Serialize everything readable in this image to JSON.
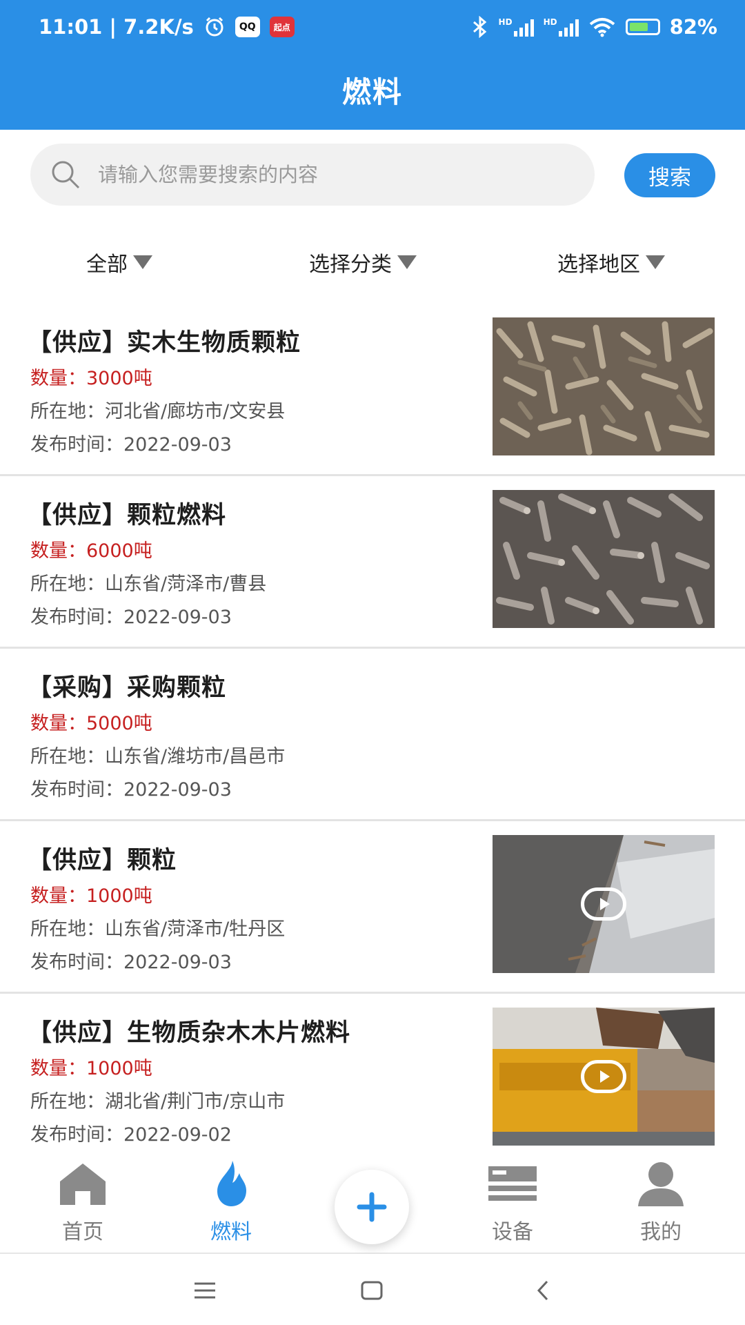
{
  "status_bar": {
    "time_speed": "11:01 | 7.2K/s",
    "qq_badge": "QQ",
    "qidian_badge": "起点",
    "hd1": "HD",
    "hd2": "HD",
    "battery": "82%"
  },
  "header": {
    "title": "燃料"
  },
  "search": {
    "placeholder": "请输入您需要搜索的内容",
    "button": "搜索"
  },
  "filters": [
    "全部",
    "选择分类",
    "选择地区"
  ],
  "listings": [
    {
      "title": "【供应】实木生物质颗粒",
      "quantity": "数量：3000吨",
      "location": "所在地：河北省/廊坊市/文安县",
      "date": "发布时间：2022-09-03",
      "media": "image"
    },
    {
      "title": "【供应】颗粒燃料",
      "quantity": "数量：6000吨",
      "location": "所在地：山东省/菏泽市/曹县",
      "date": "发布时间：2022-09-03",
      "media": "image"
    },
    {
      "title": "【采购】采购颗粒",
      "quantity": "数量：5000吨",
      "location": "所在地：山东省/潍坊市/昌邑市",
      "date": "发布时间：2022-09-03",
      "media": "none"
    },
    {
      "title": "【供应】颗粒",
      "quantity": "数量：1000吨",
      "location": "所在地：山东省/菏泽市/牡丹区",
      "date": "发布时间：2022-09-03",
      "media": "video"
    },
    {
      "title": "【供应】生物质杂木木片燃料",
      "quantity": "数量：1000吨",
      "location": "所在地：湖北省/荆门市/京山市",
      "date": "发布时间：2022-09-02",
      "media": "video"
    }
  ],
  "tabs": [
    {
      "label": "首页",
      "icon": "home-icon",
      "active": false
    },
    {
      "label": "燃料",
      "icon": "flame-icon",
      "active": true
    },
    {
      "label": "设备",
      "icon": "equipment-icon",
      "active": false
    },
    {
      "label": "我的",
      "icon": "profile-icon",
      "active": false
    }
  ],
  "colors": {
    "primary": "#2a8fe6",
    "quantity_red": "#c62020",
    "inactive_tab": "#7b7b7b"
  }
}
